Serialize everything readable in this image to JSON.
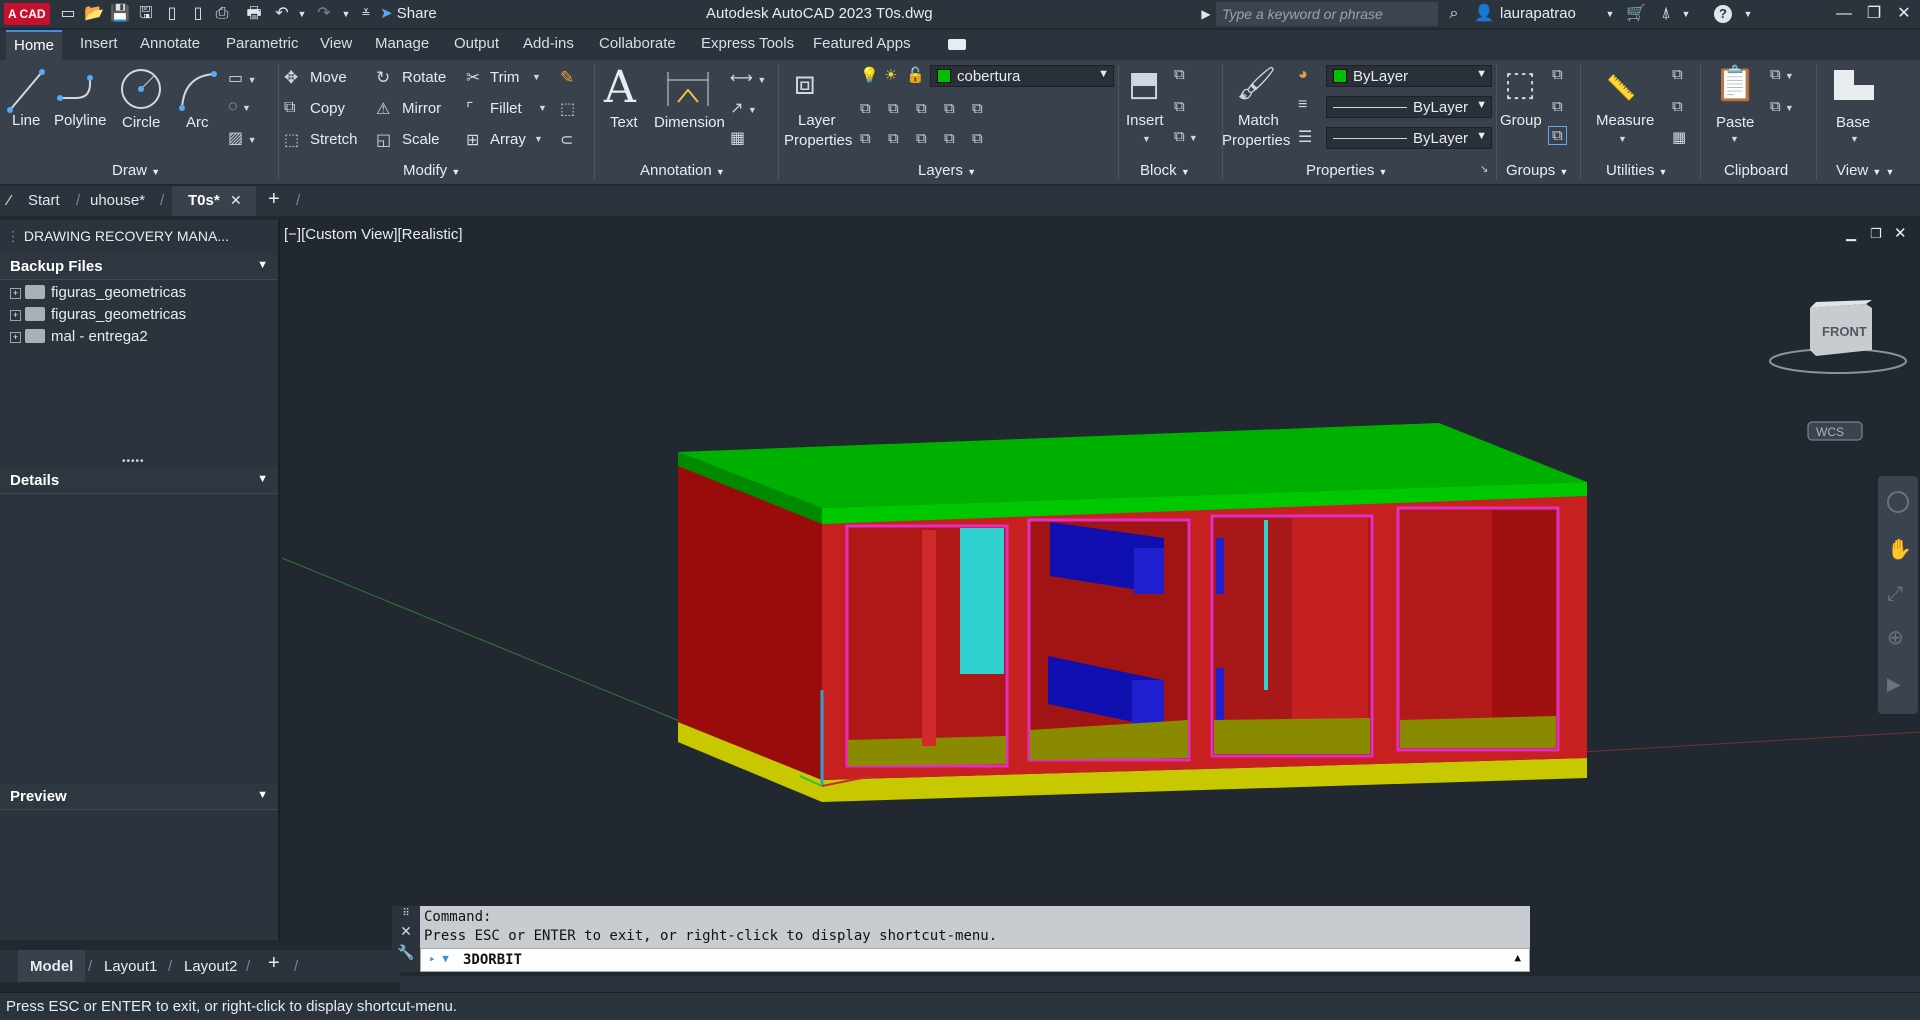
{
  "title_bar": {
    "logo": "A CAD",
    "share": "Share",
    "app_title": "Autodesk AutoCAD 2023   T0s.dwg",
    "search_placeholder": "Type a keyword or phrase",
    "user": "laurapatrao"
  },
  "ribbon_tabs": [
    "Home",
    "Insert",
    "Annotate",
    "Parametric",
    "View",
    "Manage",
    "Output",
    "Add-ins",
    "Collaborate",
    "Express Tools",
    "Featured Apps"
  ],
  "ribbon": {
    "draw": {
      "title": "Draw",
      "line": "Line",
      "polyline": "Polyline",
      "circle": "Circle",
      "arc": "Arc"
    },
    "modify": {
      "title": "Modify",
      "move": "Move",
      "rotate": "Rotate",
      "trim": "Trim",
      "copy": "Copy",
      "mirror": "Mirror",
      "fillet": "Fillet",
      "stretch": "Stretch",
      "scale": "Scale",
      "array": "Array"
    },
    "annotation": {
      "title": "Annotation",
      "text": "Text",
      "dimension": "Dimension"
    },
    "layers": {
      "title": "Layers",
      "layer_properties_1": "Layer",
      "layer_properties_2": "Properties",
      "current_layer": "cobertura"
    },
    "block": {
      "title": "Block",
      "insert": "Insert"
    },
    "properties": {
      "title": "Properties",
      "match_1": "Match",
      "match_2": "Properties",
      "color": "ByLayer",
      "linetype": "ByLayer",
      "lineweight": "ByLayer"
    },
    "groups": {
      "title": "Groups",
      "group": "Group"
    },
    "utilities": {
      "title": "Utilities",
      "measure": "Measure"
    },
    "clipboard": {
      "title": "Clipboard",
      "paste": "Paste"
    },
    "view": {
      "title": "View",
      "base": "Base"
    }
  },
  "doc_tabs": [
    "Start",
    "uhouse*",
    "T0s*"
  ],
  "palette": {
    "header": "DRAWING RECOVERY MANA...",
    "backup_title": "Backup Files",
    "files": [
      "figuras_geometricas",
      "figuras_geometricas",
      "mal - entrega2"
    ],
    "details_title": "Details",
    "preview_title": "Preview"
  },
  "viewport": {
    "label": "[−][Custom View][Realistic]",
    "viewcube_face": "FRONT",
    "wcs": "WCS"
  },
  "command": {
    "line1": "Command:",
    "line2": "Press ESC or ENTER to exit, or right-click to display shortcut-menu.",
    "input": "3DORBIT"
  },
  "layout_tabs": [
    "Model",
    "Layout1",
    "Layout2"
  ],
  "status": "Press ESC or ENTER to exit, or right-click to display shortcut-menu.",
  "colors": {
    "roof": "#00b400",
    "walls": "#c81e1e",
    "floor": "#d8d800",
    "accent": "#3d8ee8"
  }
}
